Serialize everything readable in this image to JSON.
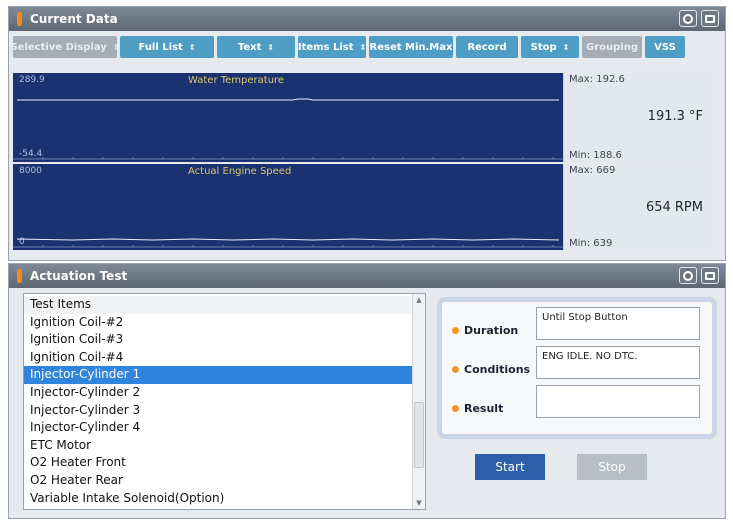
{
  "current_data": {
    "title": "Current Data",
    "toolbar": [
      {
        "label": "Selective Display",
        "caret": true,
        "disabled": true
      },
      {
        "label": "Full List",
        "caret": true,
        "disabled": false
      },
      {
        "label": "Text",
        "caret": true,
        "disabled": false
      },
      {
        "label": "Items List",
        "caret": true,
        "disabled": false
      },
      {
        "label": "Reset Min.Max",
        "caret": false,
        "disabled": false
      },
      {
        "label": "Record",
        "caret": false,
        "disabled": false
      },
      {
        "label": "Stop",
        "caret": true,
        "disabled": false
      },
      {
        "label": "Grouping",
        "caret": false,
        "disabled": true
      },
      {
        "label": "VSS",
        "caret": false,
        "disabled": false
      }
    ],
    "graphs": [
      {
        "name": "Water Temperature",
        "y_max": "289.9",
        "y_min": "-54.4",
        "max": "Max: 192.6",
        "min": "Min: 188.6",
        "value": "191.3 °F",
        "line_color": "#e8eef7"
      },
      {
        "name": "Actual Engine Speed",
        "y_max": "8000",
        "y_min": "0",
        "max": "Max: 669",
        "min": "Min: 639",
        "value": "654 RPM",
        "line_color": "#e8eef7"
      }
    ]
  },
  "actuation_test": {
    "title": "Actuation Test",
    "list": {
      "header": "Test Items",
      "items": [
        "Ignition Coil-#2",
        "Ignition Coil-#3",
        "Ignition Coil-#4",
        "Injector-Cylinder 1",
        "Injector-Cylinder 2",
        "Injector-Cylinder 3",
        "Injector-Cylinder 4",
        "ETC Motor",
        "O2 Heater Front",
        "O2 Heater Rear",
        "Variable Intake Solenoid(Option)"
      ],
      "selected_index": 3
    },
    "params": {
      "duration_label": "Duration",
      "duration_value": "Until Stop Button",
      "conditions_label": "Conditions",
      "conditions_value": "ENG IDLE. NO DTC.",
      "result_label": "Result",
      "result_value": ""
    },
    "start_label": "Start",
    "stop_label": "Stop"
  },
  "colors": {
    "graph_bg": "#1b3270",
    "accent": "#4e9dc4",
    "selection": "#2f84de",
    "title_marker": "#f28a1e"
  },
  "icons": [
    "settings-icon",
    "window-icon"
  ]
}
